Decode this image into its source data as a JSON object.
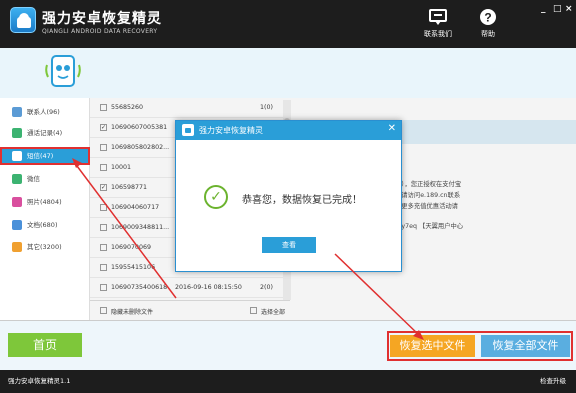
{
  "app": {
    "title": "强力安卓恢复精灵",
    "subtitle": "QIANGLI ANDROID DATA RECOVERY",
    "contact_label": "联系我们",
    "help_label": "帮助",
    "window_controls": [
      "_",
      "□",
      "×"
    ]
  },
  "sidebar": {
    "items": [
      {
        "label": "联系人(96)",
        "icon": "contacts-icon",
        "color": "#5b9bd5"
      },
      {
        "label": "通话记录(4)",
        "icon": "phone-icon",
        "color": "#3cb371"
      },
      {
        "label": "短信(47)",
        "icon": "sms-icon",
        "color": "#ffffff",
        "active": true
      },
      {
        "label": "微信",
        "icon": "wechat-icon",
        "color": "#3cb371"
      },
      {
        "label": "照片(4804)",
        "icon": "photo-icon",
        "color": "#d94f9e"
      },
      {
        "label": "文档(680)",
        "icon": "document-icon",
        "color": "#4a90d9"
      },
      {
        "label": "其它(3200)",
        "icon": "other-icon",
        "color": "#f0a030"
      }
    ]
  },
  "messages": {
    "rows": [
      {
        "phone": "55685260",
        "date": "",
        "count": "1(0)",
        "checked": false
      },
      {
        "phone": "10690607005381",
        "date": "",
        "count": "",
        "checked": true
      },
      {
        "phone": "1069805802802...",
        "date": "",
        "count": "",
        "checked": false
      },
      {
        "phone": "10001",
        "date": "",
        "count": "",
        "checked": false
      },
      {
        "phone": "106598771",
        "date": "",
        "count": "",
        "checked": true
      },
      {
        "phone": "106904060717",
        "date": "",
        "count": "",
        "checked": false
      },
      {
        "phone": "1069009348811...",
        "date": "",
        "count": "",
        "checked": false
      },
      {
        "phone": "106907006​9",
        "date": "",
        "count": "",
        "checked": false
      },
      {
        "phone": "15955415106",
        "date": "",
        "count": "",
        "checked": false
      },
      {
        "phone": "10690735400618",
        "date": "2016-09-16 08:15:50",
        "count": "2(0)",
        "checked": false
      }
    ],
    "hide_undeleted_label": "隐藏未删除文件",
    "select_all_label": "选择全部"
  },
  "detail": {
    "lines": [
      "商），您正授权在支付宝",
      "间请访问e.189.cn联系",
      "享更多充值优惠活动请",
      "Vfy7eq 【天翼用户中心"
    ]
  },
  "dialog": {
    "title": "强力安卓恢复精灵",
    "message": "恭喜您，数据恢复已完成！",
    "view_button": "查看"
  },
  "bottom": {
    "home_label": "首页",
    "recover_selected_label": "恢复选中文件",
    "recover_all_label": "恢复全部文件"
  },
  "status": {
    "version": "强力安卓恢复精灵1.1",
    "update": "检查升级"
  },
  "colors": {
    "accent_blue": "#2a9ed8",
    "green": "#7ec73a",
    "orange": "#f5a623",
    "highlight_red": "#e03030"
  }
}
